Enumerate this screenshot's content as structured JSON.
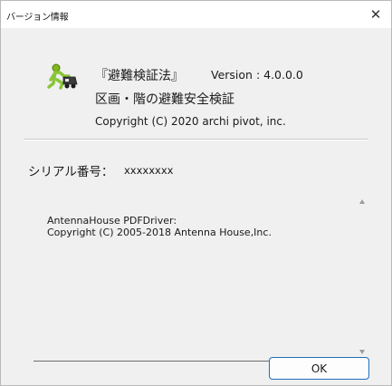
{
  "window": {
    "title": "バージョン情報",
    "close_glyph": "✕"
  },
  "app": {
    "icon": "app-icon",
    "product_title": "『避難検証法』",
    "version": "Version : 4.0.0.0",
    "subtitle": "区画・階の避難安全検証",
    "copyright": "Copyright (C) 2020 archi pivot, inc."
  },
  "serial": {
    "label": "シリアル番号：",
    "value": "xxxxxxxx"
  },
  "license": {
    "text": "AntennaHouse PDFDriver:\nCopyright (C) 2005-2018 Antenna House,Inc."
  },
  "buttons": {
    "ok_label": "OK"
  },
  "colors": {
    "accent": "#1d6fbd",
    "dialog_bg": "#f0f0f0",
    "titlebar_bg": "#ffffff"
  }
}
